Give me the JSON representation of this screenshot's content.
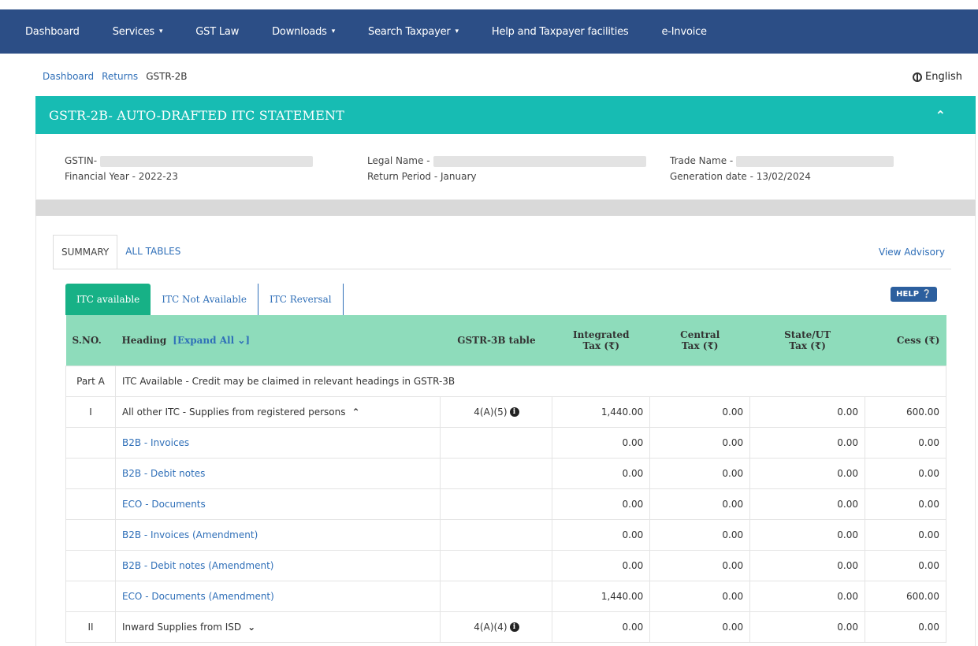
{
  "nav": {
    "items": [
      {
        "label": "Dashboard",
        "dropdown": false
      },
      {
        "label": "Services",
        "dropdown": true
      },
      {
        "label": "GST Law",
        "dropdown": false
      },
      {
        "label": "Downloads",
        "dropdown": true
      },
      {
        "label": "Search Taxpayer",
        "dropdown": true
      },
      {
        "label": "Help and Taxpayer facilities",
        "dropdown": false
      },
      {
        "label": "e-Invoice",
        "dropdown": false
      }
    ]
  },
  "breadcrumb": [
    "Dashboard",
    "Returns",
    "GSTR-2B"
  ],
  "language": "English",
  "header": {
    "title": "GSTR-2B- AUTO-DRAFTED ITC STATEMENT"
  },
  "info": {
    "gstin_label": "GSTIN-",
    "financial_year": "Financial Year - 2022-23",
    "legal_name_label": "Legal Name -",
    "return_period": "Return Period - January",
    "trade_name_label": "Trade Name -",
    "generation_date": "Generation date - 13/02/2024"
  },
  "tabs": [
    "SUMMARY",
    "ALL TABLES"
  ],
  "view_advisory": "View Advisory",
  "subtabs": [
    "ITC available",
    "ITC Not Available",
    "ITC Reversal"
  ],
  "help_label": "HELP",
  "table": {
    "headers": {
      "sno": "S.NO.",
      "heading": "Heading",
      "expand_all": "[Expand All",
      "gstr3b": "GSTR-3B table",
      "igst_1": "Integrated",
      "igst_2": "Tax (₹)",
      "cgst_1": "Central",
      "cgst_2": "Tax (₹)",
      "sgst_1": "State/UT",
      "sgst_2": "Tax (₹)",
      "cess": "Cess (₹)"
    },
    "part_a": {
      "sno": "Part A",
      "text": "ITC Available - Credit may be claimed in relevant headings in GSTR-3B"
    },
    "rows": [
      {
        "sno": "I",
        "heading": "All other ITC - Supplies from registered persons",
        "toggle": "up",
        "gstr3b": "4(A)(5)",
        "igst": "1,440.00",
        "cgst": "0.00",
        "sgst": "0.00",
        "cess": "600.00",
        "link": false
      },
      {
        "sno": "",
        "heading": "B2B - Invoices",
        "gstr3b": "",
        "igst": "0.00",
        "cgst": "0.00",
        "sgst": "0.00",
        "cess": "0.00",
        "link": true
      },
      {
        "sno": "",
        "heading": "B2B - Debit notes",
        "gstr3b": "",
        "igst": "0.00",
        "cgst": "0.00",
        "sgst": "0.00",
        "cess": "0.00",
        "link": true
      },
      {
        "sno": "",
        "heading": "ECO - Documents",
        "gstr3b": "",
        "igst": "0.00",
        "cgst": "0.00",
        "sgst": "0.00",
        "cess": "0.00",
        "link": true
      },
      {
        "sno": "",
        "heading": "B2B - Invoices (Amendment)",
        "gstr3b": "",
        "igst": "0.00",
        "cgst": "0.00",
        "sgst": "0.00",
        "cess": "0.00",
        "link": true
      },
      {
        "sno": "",
        "heading": "B2B - Debit notes (Amendment)",
        "gstr3b": "",
        "igst": "0.00",
        "cgst": "0.00",
        "sgst": "0.00",
        "cess": "0.00",
        "link": true
      },
      {
        "sno": "",
        "heading": "ECO - Documents (Amendment)",
        "gstr3b": "",
        "igst": "1,440.00",
        "cgst": "0.00",
        "sgst": "0.00",
        "cess": "600.00",
        "link": true
      },
      {
        "sno": "II",
        "heading": "Inward Supplies from ISD",
        "toggle": "down",
        "gstr3b": "4(A)(4)",
        "igst": "0.00",
        "cgst": "0.00",
        "sgst": "0.00",
        "cess": "0.00",
        "link": false
      }
    ]
  }
}
